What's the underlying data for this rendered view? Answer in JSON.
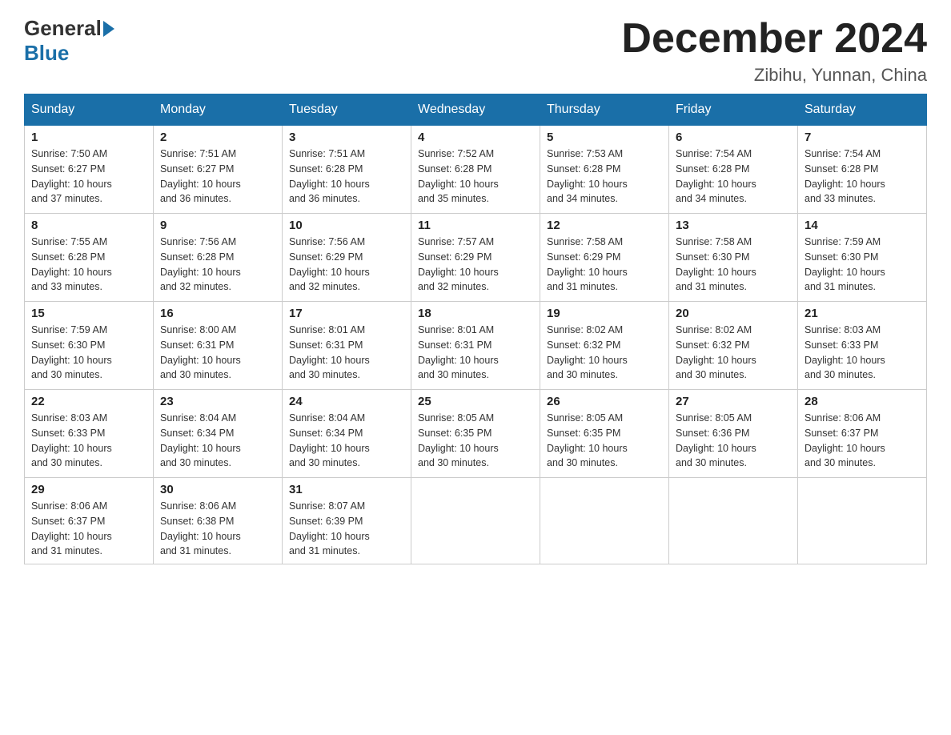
{
  "logo": {
    "general": "General",
    "blue": "Blue"
  },
  "header": {
    "title": "December 2024",
    "location": "Zibihu, Yunnan, China"
  },
  "days_of_week": [
    "Sunday",
    "Monday",
    "Tuesday",
    "Wednesday",
    "Thursday",
    "Friday",
    "Saturday"
  ],
  "weeks": [
    [
      {
        "day": "1",
        "info": "Sunrise: 7:50 AM\nSunset: 6:27 PM\nDaylight: 10 hours\nand 37 minutes."
      },
      {
        "day": "2",
        "info": "Sunrise: 7:51 AM\nSunset: 6:27 PM\nDaylight: 10 hours\nand 36 minutes."
      },
      {
        "day": "3",
        "info": "Sunrise: 7:51 AM\nSunset: 6:28 PM\nDaylight: 10 hours\nand 36 minutes."
      },
      {
        "day": "4",
        "info": "Sunrise: 7:52 AM\nSunset: 6:28 PM\nDaylight: 10 hours\nand 35 minutes."
      },
      {
        "day": "5",
        "info": "Sunrise: 7:53 AM\nSunset: 6:28 PM\nDaylight: 10 hours\nand 34 minutes."
      },
      {
        "day": "6",
        "info": "Sunrise: 7:54 AM\nSunset: 6:28 PM\nDaylight: 10 hours\nand 34 minutes."
      },
      {
        "day": "7",
        "info": "Sunrise: 7:54 AM\nSunset: 6:28 PM\nDaylight: 10 hours\nand 33 minutes."
      }
    ],
    [
      {
        "day": "8",
        "info": "Sunrise: 7:55 AM\nSunset: 6:28 PM\nDaylight: 10 hours\nand 33 minutes."
      },
      {
        "day": "9",
        "info": "Sunrise: 7:56 AM\nSunset: 6:28 PM\nDaylight: 10 hours\nand 32 minutes."
      },
      {
        "day": "10",
        "info": "Sunrise: 7:56 AM\nSunset: 6:29 PM\nDaylight: 10 hours\nand 32 minutes."
      },
      {
        "day": "11",
        "info": "Sunrise: 7:57 AM\nSunset: 6:29 PM\nDaylight: 10 hours\nand 32 minutes."
      },
      {
        "day": "12",
        "info": "Sunrise: 7:58 AM\nSunset: 6:29 PM\nDaylight: 10 hours\nand 31 minutes."
      },
      {
        "day": "13",
        "info": "Sunrise: 7:58 AM\nSunset: 6:30 PM\nDaylight: 10 hours\nand 31 minutes."
      },
      {
        "day": "14",
        "info": "Sunrise: 7:59 AM\nSunset: 6:30 PM\nDaylight: 10 hours\nand 31 minutes."
      }
    ],
    [
      {
        "day": "15",
        "info": "Sunrise: 7:59 AM\nSunset: 6:30 PM\nDaylight: 10 hours\nand 30 minutes."
      },
      {
        "day": "16",
        "info": "Sunrise: 8:00 AM\nSunset: 6:31 PM\nDaylight: 10 hours\nand 30 minutes."
      },
      {
        "day": "17",
        "info": "Sunrise: 8:01 AM\nSunset: 6:31 PM\nDaylight: 10 hours\nand 30 minutes."
      },
      {
        "day": "18",
        "info": "Sunrise: 8:01 AM\nSunset: 6:31 PM\nDaylight: 10 hours\nand 30 minutes."
      },
      {
        "day": "19",
        "info": "Sunrise: 8:02 AM\nSunset: 6:32 PM\nDaylight: 10 hours\nand 30 minutes."
      },
      {
        "day": "20",
        "info": "Sunrise: 8:02 AM\nSunset: 6:32 PM\nDaylight: 10 hours\nand 30 minutes."
      },
      {
        "day": "21",
        "info": "Sunrise: 8:03 AM\nSunset: 6:33 PM\nDaylight: 10 hours\nand 30 minutes."
      }
    ],
    [
      {
        "day": "22",
        "info": "Sunrise: 8:03 AM\nSunset: 6:33 PM\nDaylight: 10 hours\nand 30 minutes."
      },
      {
        "day": "23",
        "info": "Sunrise: 8:04 AM\nSunset: 6:34 PM\nDaylight: 10 hours\nand 30 minutes."
      },
      {
        "day": "24",
        "info": "Sunrise: 8:04 AM\nSunset: 6:34 PM\nDaylight: 10 hours\nand 30 minutes."
      },
      {
        "day": "25",
        "info": "Sunrise: 8:05 AM\nSunset: 6:35 PM\nDaylight: 10 hours\nand 30 minutes."
      },
      {
        "day": "26",
        "info": "Sunrise: 8:05 AM\nSunset: 6:35 PM\nDaylight: 10 hours\nand 30 minutes."
      },
      {
        "day": "27",
        "info": "Sunrise: 8:05 AM\nSunset: 6:36 PM\nDaylight: 10 hours\nand 30 minutes."
      },
      {
        "day": "28",
        "info": "Sunrise: 8:06 AM\nSunset: 6:37 PM\nDaylight: 10 hours\nand 30 minutes."
      }
    ],
    [
      {
        "day": "29",
        "info": "Sunrise: 8:06 AM\nSunset: 6:37 PM\nDaylight: 10 hours\nand 31 minutes."
      },
      {
        "day": "30",
        "info": "Sunrise: 8:06 AM\nSunset: 6:38 PM\nDaylight: 10 hours\nand 31 minutes."
      },
      {
        "day": "31",
        "info": "Sunrise: 8:07 AM\nSunset: 6:39 PM\nDaylight: 10 hours\nand 31 minutes."
      },
      {
        "day": "",
        "info": ""
      },
      {
        "day": "",
        "info": ""
      },
      {
        "day": "",
        "info": ""
      },
      {
        "day": "",
        "info": ""
      }
    ]
  ]
}
